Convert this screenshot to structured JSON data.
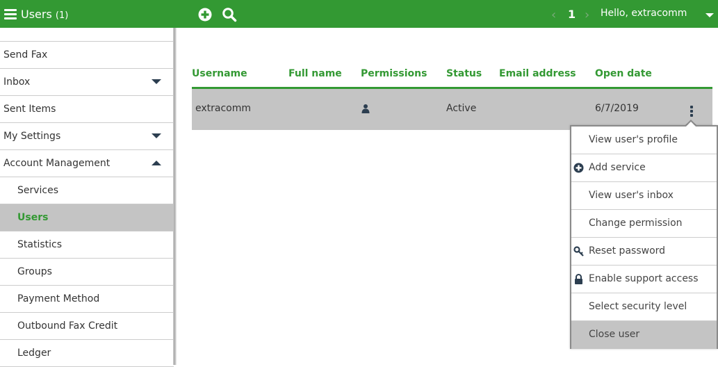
{
  "topbar": {
    "title": "Users",
    "count": "(1)",
    "icons": {
      "menu": "hamburger-icon",
      "add": "plus-circle-icon",
      "search": "search-icon"
    },
    "pager": {
      "prev": "‹",
      "current": "1",
      "next": "›"
    },
    "greeting": "Hello, extracomm"
  },
  "sidebar": {
    "items": [
      {
        "label": "Send Fax",
        "caret": null
      },
      {
        "label": "Inbox",
        "caret": "down"
      },
      {
        "label": "Sent Items",
        "caret": null
      },
      {
        "label": "My Settings",
        "caret": "down"
      },
      {
        "label": "Account Management",
        "caret": "up"
      },
      {
        "label": "Services",
        "sub": true
      },
      {
        "label": "Users",
        "sub": true,
        "active": true
      },
      {
        "label": "Statistics",
        "sub": true
      },
      {
        "label": "Groups",
        "sub": true
      },
      {
        "label": "Payment Method",
        "sub": true
      },
      {
        "label": "Outbound Fax Credit",
        "sub": true
      },
      {
        "label": "Ledger",
        "sub": true
      }
    ]
  },
  "table": {
    "columns": [
      "Username",
      "Full name",
      "Permissions",
      "Status",
      "Email address",
      "Open date"
    ],
    "rows": [
      {
        "username": "extracomm",
        "full_name": "",
        "permissions": "user-icon",
        "status": "Active",
        "email": "",
        "open_date": "6/7/2019"
      }
    ]
  },
  "context_menu": {
    "items": [
      {
        "label": "View user's profile",
        "icon": null
      },
      {
        "label": "Add service",
        "icon": "plus-circle-icon"
      },
      {
        "label": "View user's inbox",
        "icon": null
      },
      {
        "label": "Change permission",
        "icon": null
      },
      {
        "label": "Reset password",
        "icon": "key-icon"
      },
      {
        "label": "Enable support access",
        "icon": "lock-icon"
      },
      {
        "label": "Select security level",
        "icon": null
      },
      {
        "label": "Close user",
        "icon": null,
        "hovered": true
      }
    ]
  },
  "colors": {
    "brand": "#339933",
    "selected_bg": "#c4c4c4",
    "icon_dark": "#2c3e50"
  }
}
